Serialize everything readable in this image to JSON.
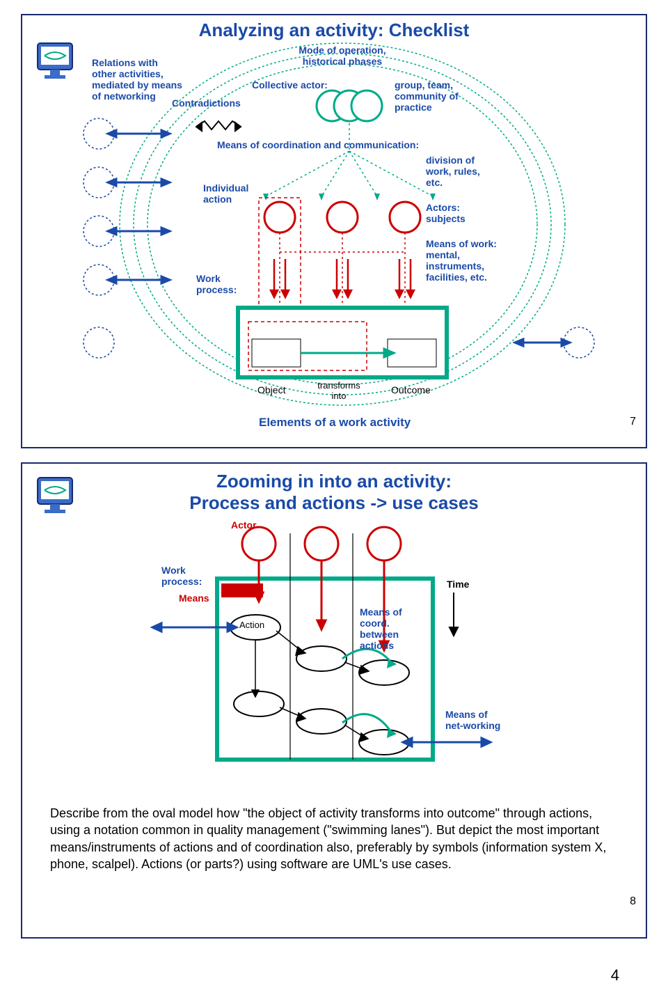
{
  "slide1": {
    "title": "Analyzing an activity: Checklist",
    "relations": "Relations with other activities, mediated by means of networking",
    "contradictions": "Contradictions",
    "mode": "Mode of operation, historical phases",
    "collective": "Collective actor:",
    "group": "group, team, community of practice",
    "coord": "Means of coordination and communication:",
    "division": "division of work, rules, etc.",
    "individual": "Individual action",
    "actors": "Actors: subjects",
    "meanswork": "Means of work: mental, instruments, facilities, etc.",
    "workprocess": "Work process:",
    "object": "Object",
    "transforms": "transforms into",
    "outcome": "Outcome",
    "elements": "Elements of a work activity",
    "num": "7"
  },
  "slide2": {
    "title1": "Zooming in into an activity:",
    "title2": "Process and actions -> use cases",
    "actor": "Actor",
    "workprocess": "Work process:",
    "means": "Means",
    "action": "Action",
    "meanscoord": "Means of coord. between actions",
    "time": "Time",
    "meansnet": "Means of net-working",
    "desc": "Describe from the oval model how \"the object of activity transforms into outcome\" through actions, using a notation common in quality management (\"swimming lanes\"). But depict the most important means/instruments of actions and of coordination also, preferably by symbols (information system X, phone, scalpel). Actions (or parts?) using software are UML's use cases.",
    "num": "8"
  },
  "page": "4"
}
